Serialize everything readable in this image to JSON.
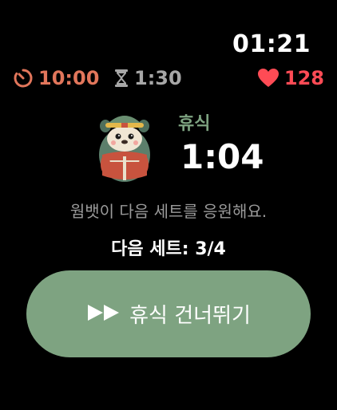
{
  "status": {
    "time": "01:21"
  },
  "stats": {
    "total_time": "10:00",
    "rest_duration": "1:30",
    "heart_rate": "128",
    "colors": {
      "total": "#e2765b",
      "rest": "#a7a7a7",
      "heart": "#ff4b55"
    }
  },
  "rest": {
    "label": "휴식",
    "countdown": "1:04",
    "mascot": "wombat-mascot"
  },
  "message": "웜뱃이 다음 세트를 응원해요.",
  "next_set": "다음 세트: 3/4",
  "skip_button": {
    "label": "휴식 건너뛰기",
    "icon": "fast-forward-icon",
    "color": "#7ea381"
  }
}
